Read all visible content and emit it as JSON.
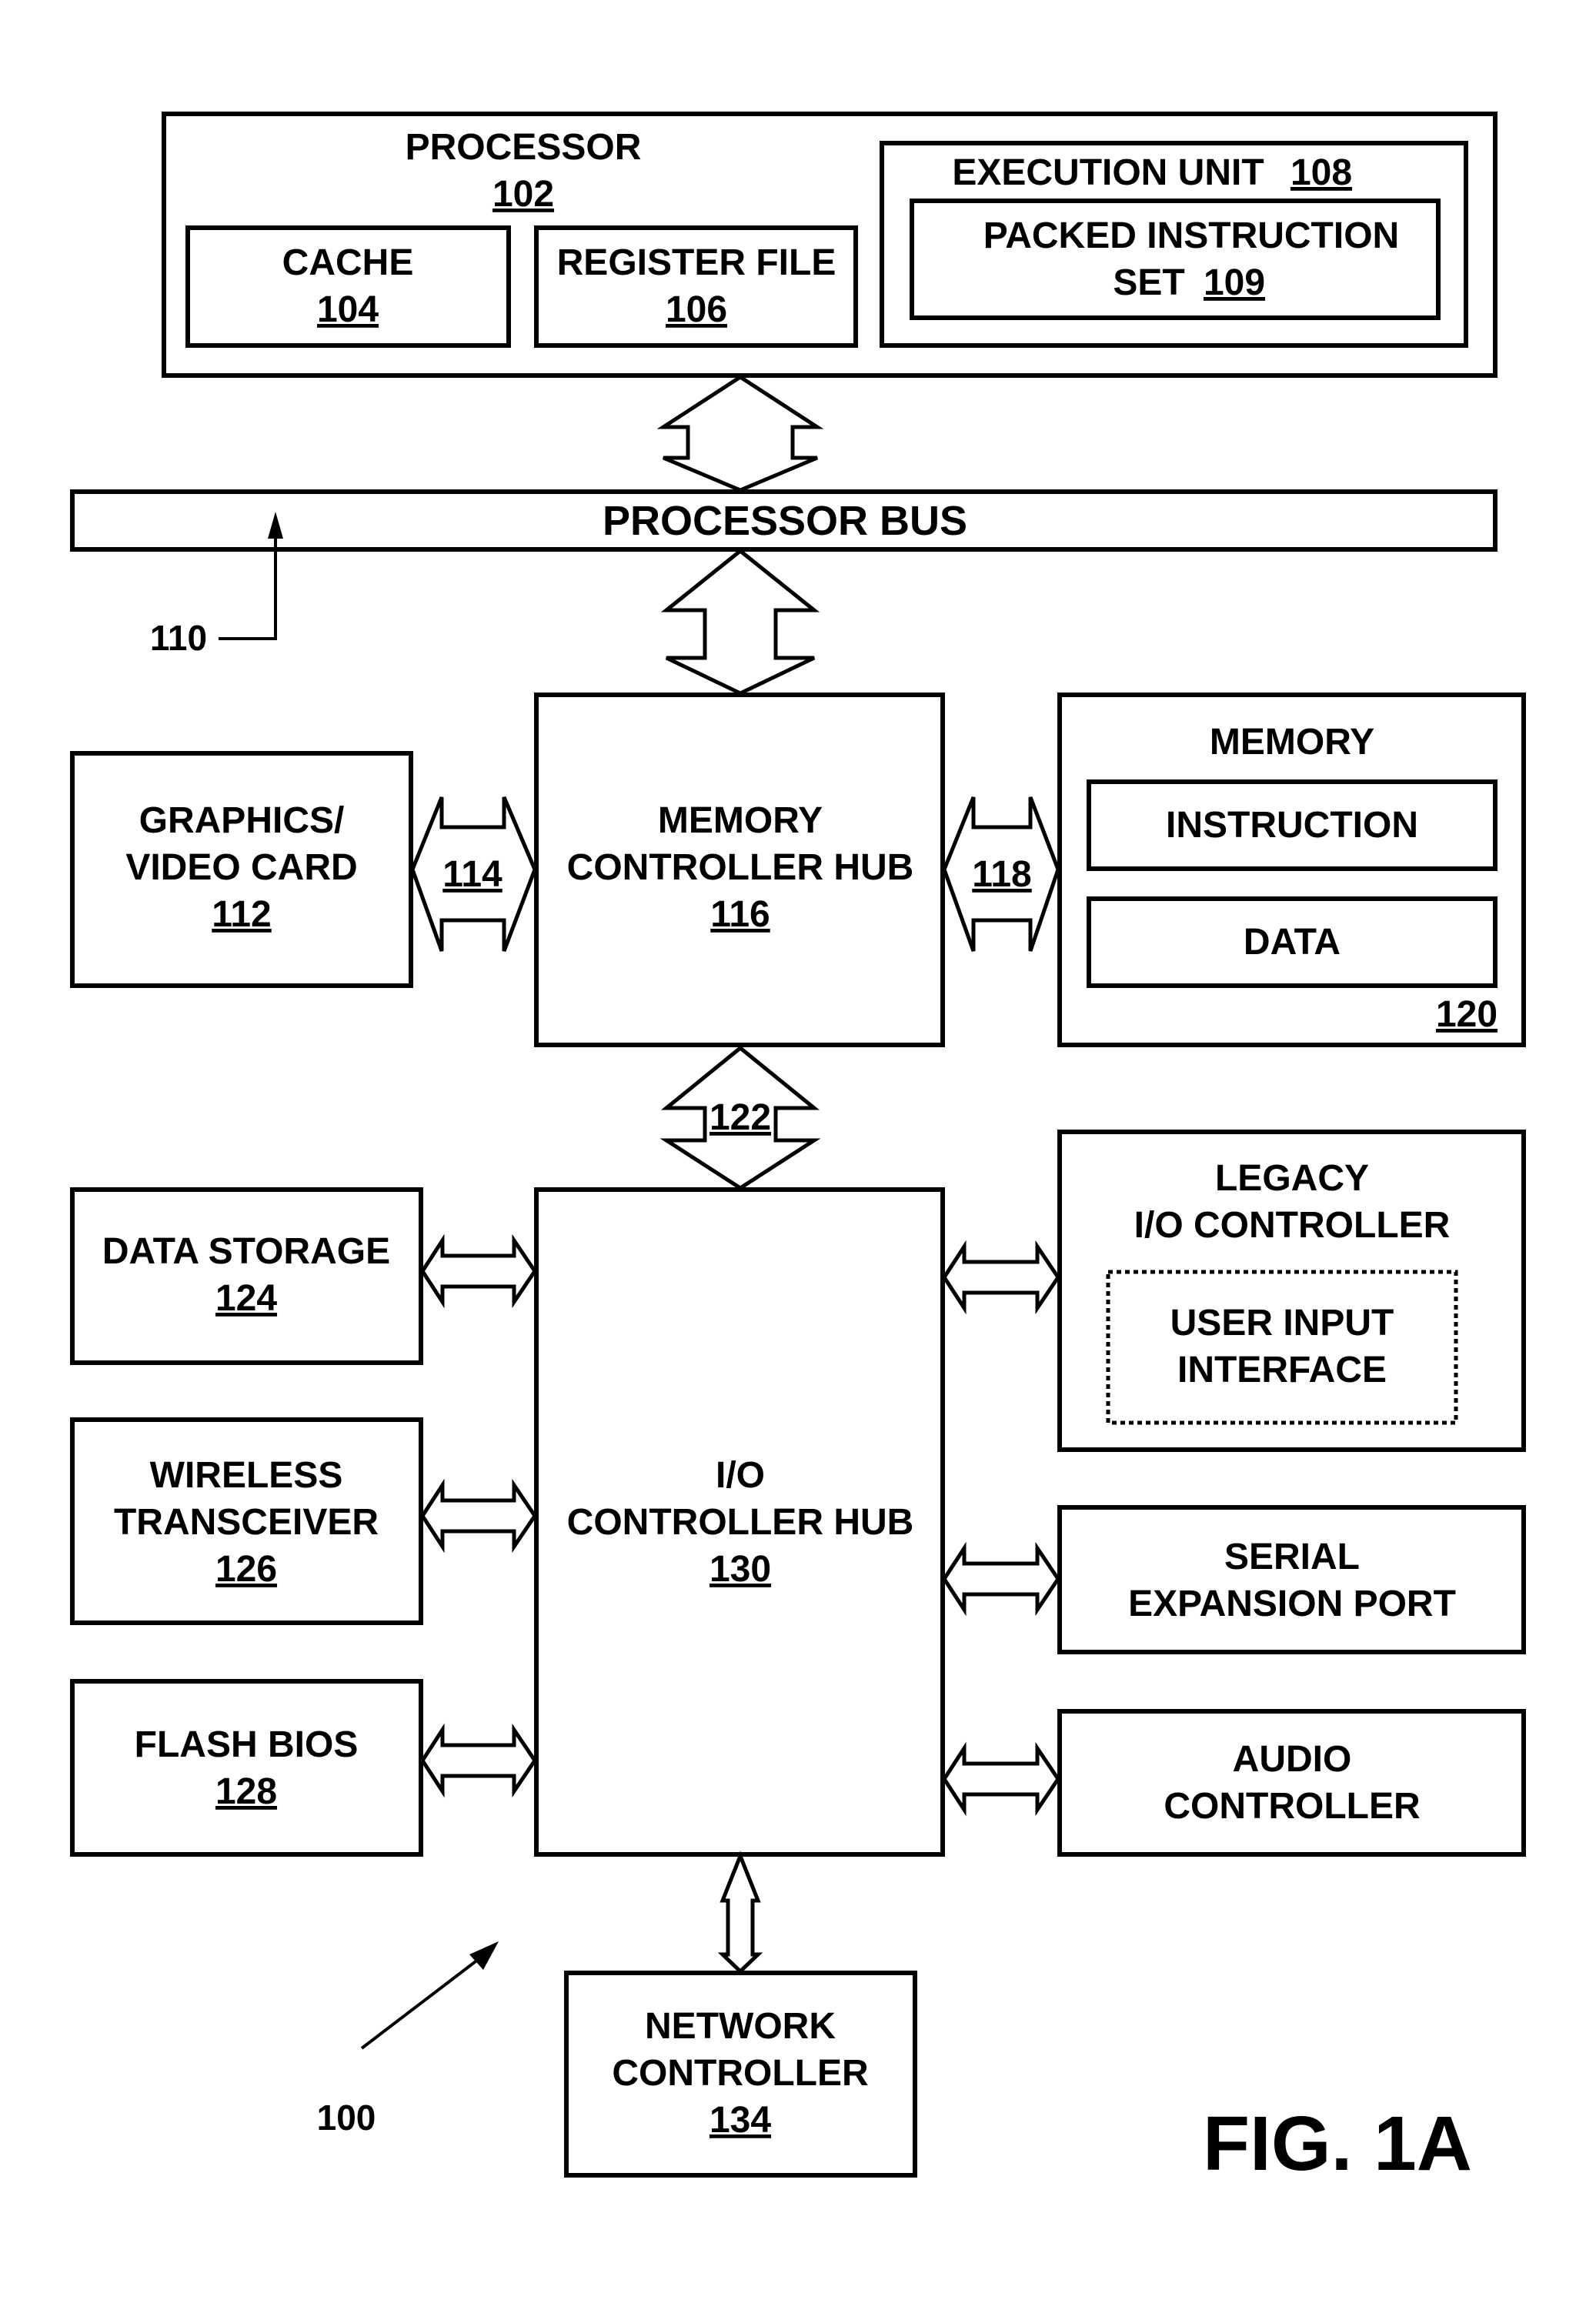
{
  "figure": {
    "title": "FIG. 1A",
    "system_ref": "100",
    "blocks": {
      "processor": {
        "label": "PROCESSOR",
        "ref": "102"
      },
      "cache": {
        "label": "CACHE",
        "ref": "104"
      },
      "register_file": {
        "label": "REGISTER FILE",
        "ref": "106"
      },
      "execution_unit": {
        "label": "EXECUTION UNIT",
        "ref": "108"
      },
      "packed_instruction_set": {
        "line1": "PACKED INSTRUCTION",
        "line2": "SET",
        "ref": "109"
      },
      "processor_bus": {
        "label": "PROCESSOR BUS",
        "ref": "110"
      },
      "graphics": {
        "line1": "GRAPHICS/",
        "line2": "VIDEO CARD",
        "ref": "112"
      },
      "memory_controller_hub": {
        "line1": "MEMORY",
        "line2": "CONTROLLER HUB",
        "ref": "116"
      },
      "memory": {
        "label": "MEMORY",
        "instruction": "INSTRUCTION",
        "data": "DATA",
        "ref": "120"
      },
      "io_controller_hub": {
        "line1": "I/O",
        "line2": "CONTROLLER HUB",
        "ref": "130"
      },
      "data_storage": {
        "label": "DATA STORAGE",
        "ref": "124"
      },
      "wireless_transceiver": {
        "line1": "WIRELESS",
        "line2": "TRANSCEIVER",
        "ref": "126"
      },
      "flash_bios": {
        "label": "FLASH BIOS",
        "ref": "128"
      },
      "legacy_io": {
        "line1": "LEGACY",
        "line2": "I/O CONTROLLER",
        "user_input_line1": "USER INPUT",
        "user_input_line2": "INTERFACE"
      },
      "serial_expansion_port": {
        "line1": "SERIAL",
        "line2": "EXPANSION PORT"
      },
      "audio_controller": {
        "line1": "AUDIO",
        "line2": "CONTROLLER"
      },
      "network_controller": {
        "line1": "NETWORK",
        "line2": "CONTROLLER",
        "ref": "134"
      }
    },
    "links": {
      "graphics_link": "114",
      "memory_link": "118",
      "hub_link": "122"
    }
  }
}
